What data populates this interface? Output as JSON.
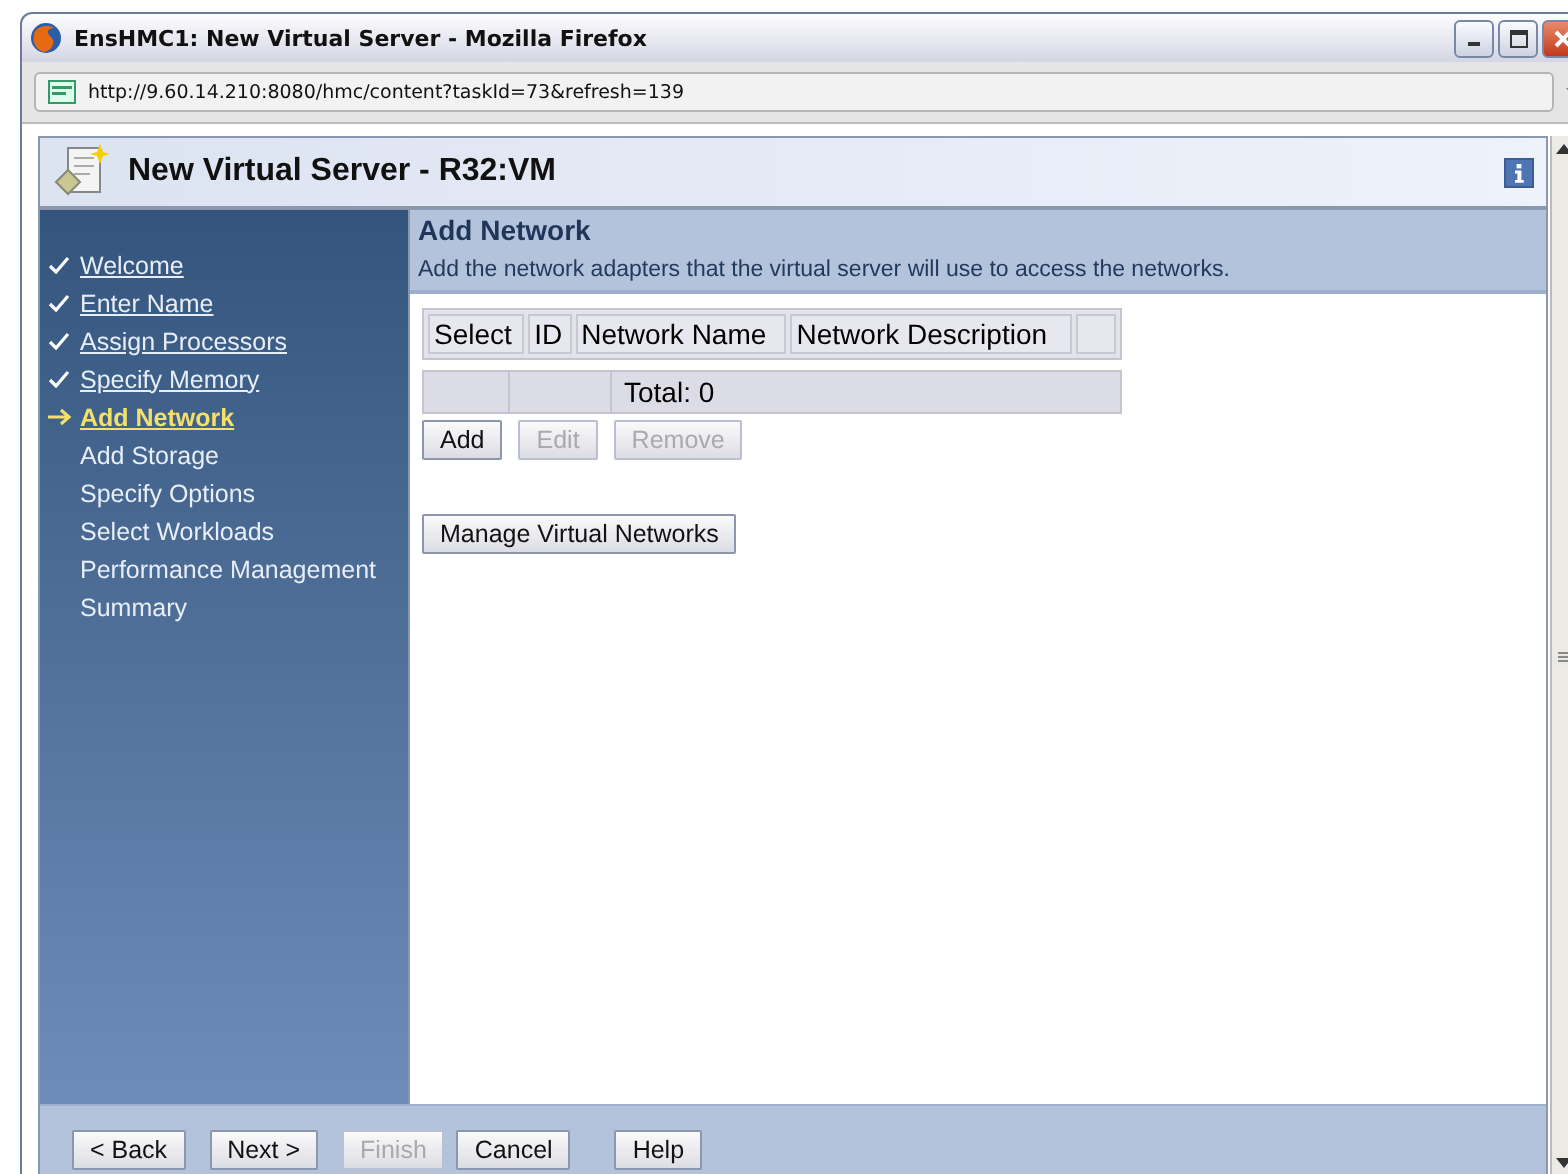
{
  "window": {
    "title": "EnsHMC1: New Virtual Server - Mozilla Firefox"
  },
  "address_bar": {
    "url": "http://9.60.14.210:8080/hmc/content?taskId=73&refresh=139"
  },
  "wizard": {
    "title": "New Virtual Server - R32:VM"
  },
  "steps": [
    {
      "label": "Welcome",
      "completed": true,
      "selected": false
    },
    {
      "label": "Enter Name",
      "completed": true,
      "selected": false
    },
    {
      "label": "Assign Processors",
      "completed": true,
      "selected": false
    },
    {
      "label": "Specify Memory",
      "completed": true,
      "selected": false
    },
    {
      "label": "Add Network",
      "completed": false,
      "selected": true
    },
    {
      "label": "Add Storage",
      "completed": false,
      "selected": false
    },
    {
      "label": "Specify Options",
      "completed": false,
      "selected": false
    },
    {
      "label": "Select Workloads",
      "completed": false,
      "selected": false
    },
    {
      "label": "Performance Management",
      "completed": false,
      "selected": false
    },
    {
      "label": "Summary",
      "completed": false,
      "selected": false
    }
  ],
  "page": {
    "title": "Add Network",
    "description": "Add the network adapters that the virtual server will use to access the networks."
  },
  "table": {
    "columns": [
      "Select",
      "ID",
      "Network Name",
      "Network Description"
    ],
    "total": "Total: 0"
  },
  "table_buttons": [
    {
      "label": "Add",
      "disabled": false
    },
    {
      "label": "Edit",
      "disabled": true
    },
    {
      "label": "Remove",
      "disabled": true
    }
  ],
  "manage_button": {
    "label": "Manage Virtual Networks"
  },
  "footer_buttons": [
    {
      "label": "< Back",
      "disabled": false
    },
    {
      "label": "Next >",
      "disabled": false
    },
    {
      "label": "Finish",
      "disabled": true
    },
    {
      "label": "Cancel",
      "disabled": false
    },
    {
      "label": "Help",
      "disabled": false
    }
  ]
}
